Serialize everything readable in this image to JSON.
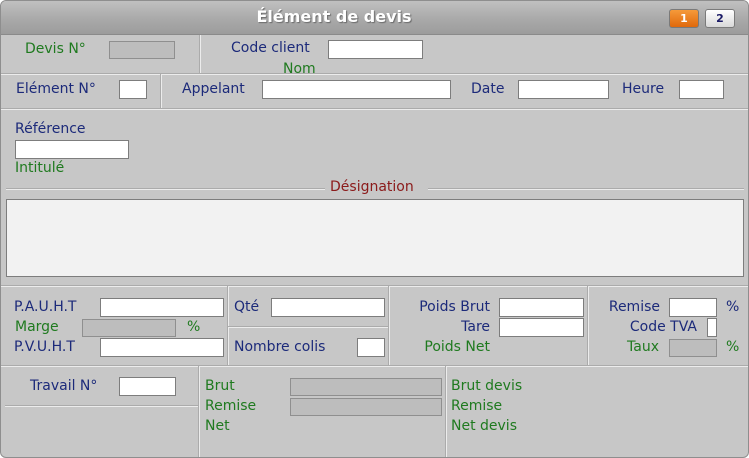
{
  "window": {
    "title": "Élément de devis",
    "page_buttons": [
      "1",
      "2"
    ]
  },
  "header": {
    "devis_label": "Devis N°",
    "code_client_label": "Code client",
    "nom_label": "Nom"
  },
  "row2": {
    "element_label": "Elément N°",
    "appelant_label": "Appelant",
    "date_label": "Date",
    "heure_label": "Heure"
  },
  "reference": {
    "reference_label": "Référence",
    "intitule_label": "Intitulé"
  },
  "designation": {
    "legend": "Désignation"
  },
  "pricing": {
    "pauht_label": "P.A.U.H.T",
    "marge_label": "Marge",
    "marge_unit": "%",
    "pvuht_label": "P.V.U.H.T",
    "qte_label": "Qté",
    "nombre_colis_label": "Nombre colis",
    "poids_brut_label": "Poids Brut",
    "tare_label": "Tare",
    "poids_net_label": "Poids Net",
    "remise_label": "Remise",
    "remise_unit": "%",
    "code_tva_label": "Code TVA",
    "taux_label": "Taux",
    "taux_unit": "%"
  },
  "totals": {
    "travail_label": "Travail N°",
    "brut_label": "Brut",
    "remise_label": "Remise",
    "net_label": "Net",
    "brut_devis_label": "Brut devis",
    "remise_devis_label": "Remise",
    "net_devis_label": "Net devis"
  }
}
